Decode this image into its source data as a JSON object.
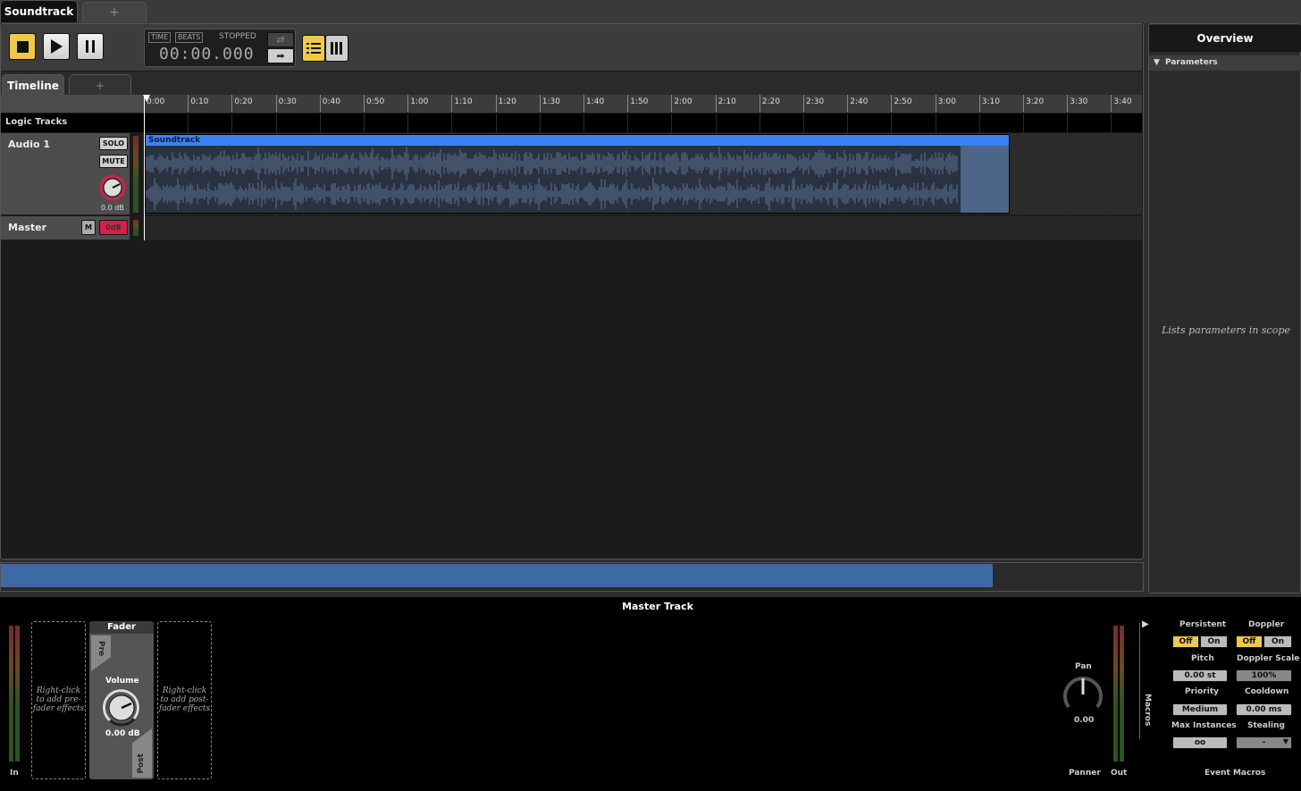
{
  "doc_tabs": {
    "active": "Soundtrack",
    "add": "+"
  },
  "transport": {
    "time_mode": "TIME",
    "beats_mode": "BEATS",
    "status": "STOPPED",
    "time": "00:00.000"
  },
  "editor_tabs": {
    "timeline": "Timeline",
    "add": "+"
  },
  "ruler": [
    "0:00",
    "0:10",
    "0:20",
    "0:30",
    "0:40",
    "0:50",
    "1:00",
    "1:10",
    "1:20",
    "1:30",
    "1:40",
    "1:50",
    "2:00",
    "2:10",
    "2:20",
    "2:30",
    "2:40",
    "2:50",
    "3:00",
    "3:10",
    "3:20",
    "3:30",
    "3:40"
  ],
  "logic_tracks_label": "Logic Tracks",
  "tracks": {
    "audio": {
      "name": "Audio 1",
      "solo": "SOLO",
      "mute": "MUTE",
      "volume": "0.0 dB",
      "region": "Soundtrack"
    },
    "master": {
      "name": "Master",
      "m": "M",
      "volume": "0dB"
    }
  },
  "overview": {
    "title": "Overview",
    "parameters": "Parameters",
    "hint": "Lists parameters in scope"
  },
  "master_track": {
    "title": "Master Track",
    "in_label": "In",
    "out_label": "Out",
    "pre_fx_hint": "Right-click to add pre-fader effects",
    "post_fx_hint": "Right-click to add post-fader effects",
    "fader": {
      "title": "Fader",
      "pre": "Pre",
      "post": "Post",
      "volume_label": "Volume",
      "volume_value": "0.00 dB"
    },
    "panner": {
      "pan_label": "Pan",
      "pan_value": "0.00",
      "section": "Panner"
    },
    "macros_label": "Macros",
    "event_macros": {
      "section": "Event Macros",
      "persistent": {
        "label": "Persistent",
        "off": "Off",
        "on": "On"
      },
      "doppler": {
        "label": "Doppler",
        "off": "Off",
        "on": "On"
      },
      "pitch": {
        "label": "Pitch",
        "value": "0.00 st"
      },
      "doppler_scale": {
        "label": "Doppler Scale",
        "value": "100%"
      },
      "priority": {
        "label": "Priority",
        "value": "Medium"
      },
      "cooldown": {
        "label": "Cooldown",
        "value": "0.00 ms"
      },
      "max_instances": {
        "label": "Max Instances",
        "value": "oo"
      },
      "stealing": {
        "label": "Stealing",
        "value": "-"
      }
    }
  },
  "colors": {
    "accent": "#f0c84a",
    "region": "#3b82f6",
    "master_volume": "#d81e4a"
  }
}
